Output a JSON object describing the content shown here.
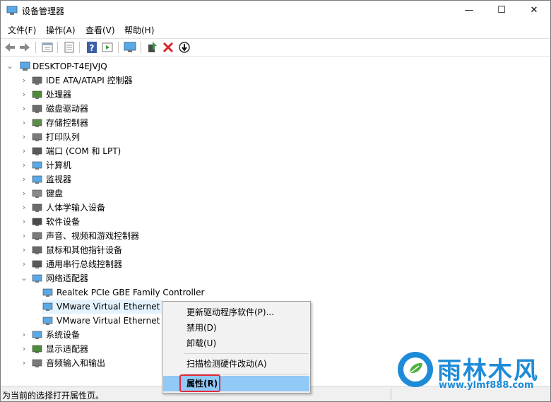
{
  "window": {
    "title": "设备管理器",
    "minimize": "—",
    "maximize": "☐",
    "close": "✕"
  },
  "menu": [
    "文件(F)",
    "操作(A)",
    "查看(V)",
    "帮助(H)"
  ],
  "toolbar": [
    "back-icon",
    "forward-icon",
    "properties-icon",
    "show-hide-icon",
    "help-icon",
    "action-icon",
    "monitor-icon",
    "update-driver-icon",
    "uninstall-icon",
    "download-icon"
  ],
  "tree": {
    "root": "DESKTOP-T4EJVJQ",
    "categories": [
      {
        "label": "IDE ATA/ATAPI 控制器",
        "icon": "ide-icon"
      },
      {
        "label": "处理器",
        "icon": "cpu-icon"
      },
      {
        "label": "磁盘驱动器",
        "icon": "disk-icon"
      },
      {
        "label": "存储控制器",
        "icon": "storage-icon"
      },
      {
        "label": "打印队列",
        "icon": "printer-icon"
      },
      {
        "label": "端口 (COM 和 LPT)",
        "icon": "port-icon"
      },
      {
        "label": "计算机",
        "icon": "computer-icon"
      },
      {
        "label": "监视器",
        "icon": "monitor-icon"
      },
      {
        "label": "键盘",
        "icon": "keyboard-icon"
      },
      {
        "label": "人体学输入设备",
        "icon": "hid-icon"
      },
      {
        "label": "软件设备",
        "icon": "software-icon"
      },
      {
        "label": "声音、视频和游戏控制器",
        "icon": "sound-icon"
      },
      {
        "label": "鼠标和其他指针设备",
        "icon": "mouse-icon"
      },
      {
        "label": "通用串行总线控制器",
        "icon": "usb-icon"
      },
      {
        "label": "网络适配器",
        "icon": "network-icon"
      }
    ],
    "network_children": [
      "Realtek PCIe GBE Family Controller",
      "VMware Virtual Ethernet",
      "VMware Virtual Ethernet"
    ],
    "after": [
      {
        "label": "系统设备",
        "icon": "system-icon"
      },
      {
        "label": "显示适配器",
        "icon": "display-icon"
      },
      {
        "label": "音频输入和输出",
        "icon": "audio-icon"
      }
    ]
  },
  "context_menu": {
    "update": "更新驱动程序软件(P)...",
    "disable": "禁用(D)",
    "uninstall": "卸载(U)",
    "scan": "扫描检测硬件改动(A)",
    "properties": "属性(R)"
  },
  "status": "为当前的选择打开属性页。",
  "watermark": {
    "title": "雨林木风",
    "url": "www.ylmf888.com"
  },
  "colors": {
    "accent": "#1e8bd8",
    "selection": "#91c9f7",
    "highlight_box": "#e32b3c"
  }
}
